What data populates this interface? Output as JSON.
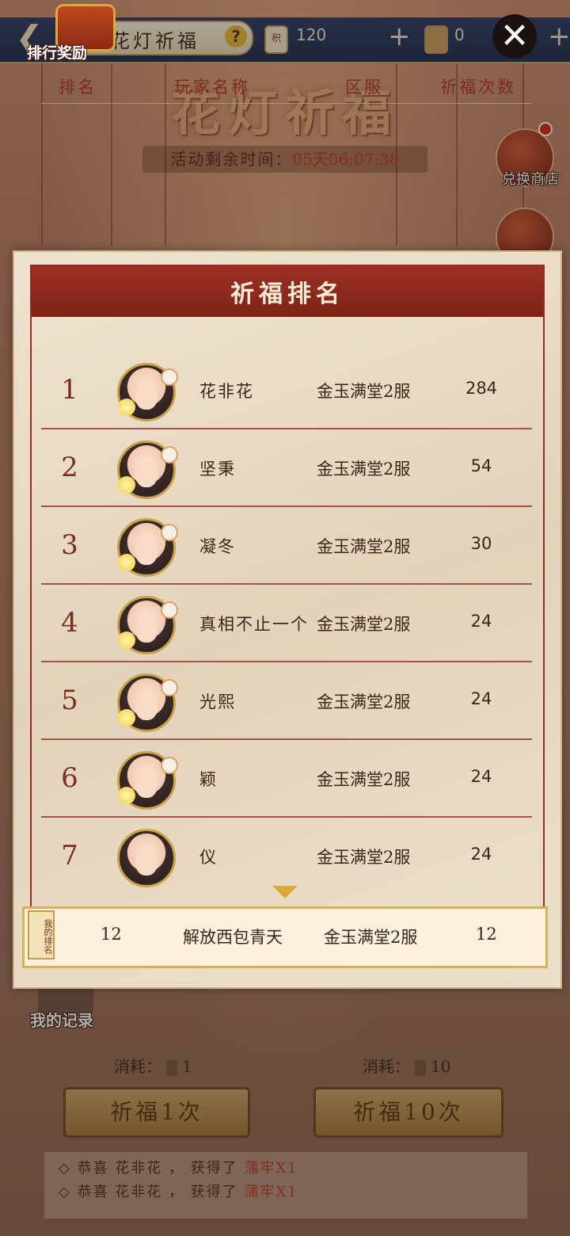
{
  "topbar": {
    "title": "花灯祈福",
    "help": "?",
    "currency1": {
      "icon_text": "积",
      "value": "120"
    },
    "currency2": {
      "value": "0"
    },
    "plus": "+"
  },
  "background": {
    "title": "花灯祈福",
    "timer_label": "活动剩余时间：",
    "timer_value": "05天06:07:38",
    "shop_label": "兑换商店"
  },
  "ranking": {
    "title": "祈福排名",
    "reward_label": "排行奖励",
    "columns": [
      "排名",
      "玩家名称",
      "区服",
      "祈福次数"
    ],
    "rows": [
      {
        "rank": "1",
        "name": "花非花",
        "server": "金玉满堂2服",
        "count": "284"
      },
      {
        "rank": "2",
        "name": "坚秉",
        "server": "金玉满堂2服",
        "count": "54"
      },
      {
        "rank": "3",
        "name": "凝冬",
        "server": "金玉满堂2服",
        "count": "30"
      },
      {
        "rank": "4",
        "name": "真相不止一个",
        "server": "金玉满堂2服",
        "count": "24"
      },
      {
        "rank": "5",
        "name": "光熙",
        "server": "金玉满堂2服",
        "count": "24"
      },
      {
        "rank": "6",
        "name": "颖",
        "server": "金玉满堂2服",
        "count": "24"
      },
      {
        "rank": "7",
        "name": "仪",
        "server": "金玉满堂2服",
        "count": "24"
      }
    ],
    "my": {
      "tag": "我的排名",
      "rank": "12",
      "name": "解放西包青天",
      "server": "金玉满堂2服",
      "count": "12"
    }
  },
  "bottom": {
    "record_label": "我的记录",
    "cost_label": "消耗：",
    "cost1": "1",
    "cost10": "10",
    "btn1": "祈福1次",
    "btn10": "祈福10次",
    "log": [
      {
        "prefix": "◇ 恭喜 花非花 ， 获得了 ",
        "item": "蒲牢X1"
      },
      {
        "prefix": "◇ 恭喜 花非花 ， 获得了 ",
        "item": "蒲牢X1"
      }
    ]
  }
}
